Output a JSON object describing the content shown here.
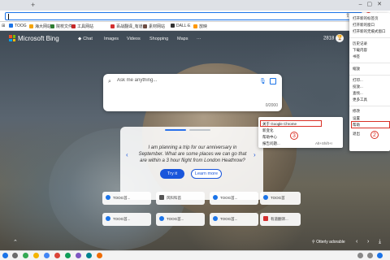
{
  "browser": {
    "address_value": "",
    "extension_badge": "ABP",
    "bookmarks": [
      {
        "label": "TOOG",
        "color": "#1a73e8"
      },
      {
        "label": "海大网站",
        "color": "#f4a300"
      },
      {
        "label": "院校文件",
        "color": "#2e7d32"
      },
      {
        "label": "工具网站",
        "color": "#c62828"
      },
      {
        "label": "百战翻译_有道",
        "color": "#d32f2f"
      },
      {
        "label": "素材网站",
        "color": "#6d4c41"
      },
      {
        "label": "DALL·E",
        "color": "#333333"
      },
      {
        "label": "放映",
        "color": "#ff9800"
      }
    ]
  },
  "bing": {
    "logo": "Microsoft Bing",
    "nav": [
      "Chat",
      "Images",
      "Videos",
      "Shopping",
      "Maps",
      "···"
    ],
    "points": "2818",
    "search_placeholder": "Ask me anything...",
    "char_count": "0/2000",
    "chat_prompt": "I am planning a trip for our anniversary in September. What are some places we can go that are within a 3 hour flight from London Heathrow?",
    "try_it": "Try it",
    "learn_more": "Learn more",
    "tiles": [
      {
        "label": "TOOG首...",
        "color": "#1a73e8"
      },
      {
        "label": "风科科首",
        "color": "#555555"
      },
      {
        "label": "TOOG首...",
        "color": "#1a73e8"
      },
      {
        "label": "TOOG首",
        "color": "#1a73e8"
      },
      {
        "label": "TOOG首...",
        "color": "#1a73e8"
      },
      {
        "label": "TOOG首...",
        "color": "#1a73e8"
      },
      {
        "label": "TOOG首...",
        "color": "#1a73e8"
      },
      {
        "label": "有道翻译...",
        "color": "#d32f2f"
      }
    ],
    "location": "Otterly adorable"
  },
  "chrome_menu": {
    "items": [
      {
        "label": "打开新的标签页"
      },
      {
        "label": "打开新的窗口"
      },
      {
        "label": "打开新的无痕式窗口"
      },
      {
        "label": "历史记录"
      },
      {
        "label": "下载内容"
      },
      {
        "label": "书签"
      },
      {
        "label": "缩放"
      },
      {
        "label": "打印..."
      },
      {
        "label": "投放..."
      },
      {
        "label": "查找..."
      },
      {
        "label": "更多工具"
      },
      {
        "label": "修改"
      },
      {
        "label": "设置"
      },
      {
        "label": "帮助"
      },
      {
        "label": "退出"
      }
    ],
    "help_submenu": [
      {
        "label": "关于 Google Chrome",
        "shortcut": ""
      },
      {
        "label": "新变化",
        "shortcut": ""
      },
      {
        "label": "帮助中心",
        "shortcut": ""
      },
      {
        "label": "报告问题...",
        "shortcut": "Alt+Shift+I"
      }
    ]
  },
  "annotations": {
    "step_help": "2",
    "step_about": "3"
  }
}
